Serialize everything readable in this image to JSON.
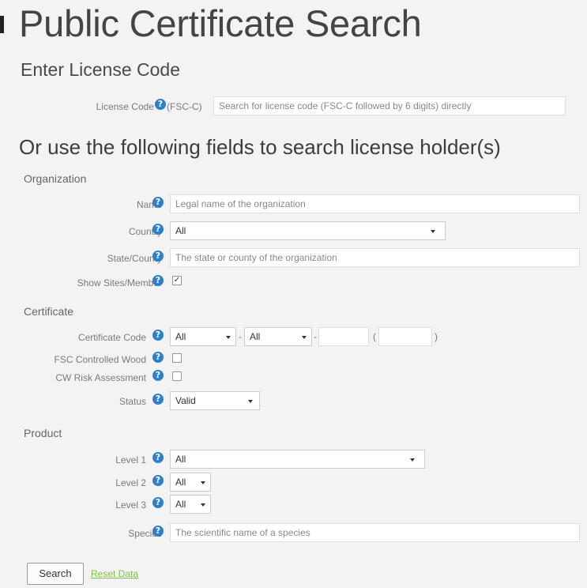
{
  "title": "Public Certificate Search",
  "license_section": {
    "heading": "Enter License Code",
    "label": "License Code",
    "prefix": "(FSC-C)",
    "placeholder": "Search for license code (FSC-C followed by 6 digits) directly"
  },
  "search_heading": "Or use the following fields to search license holder(s)",
  "organization": {
    "heading": "Organization",
    "name_label": "Name",
    "name_placeholder": "Legal name of the organization",
    "country_label": "Country",
    "country_value": "All",
    "state_label": "State/County",
    "state_placeholder": "The state or county of the organization",
    "show_sites_label": "Show Sites/Member",
    "show_sites_checked": true
  },
  "certificate": {
    "heading": "Certificate",
    "code_label": "Certificate Code",
    "code_select1": "All",
    "code_select2": "All",
    "sep1": "-",
    "sep2": "-",
    "paren_open": "(",
    "paren_close": ")",
    "controlled_wood_label": "FSC Controlled Wood",
    "controlled_wood_checked": false,
    "cw_risk_label": "CW Risk Assessment",
    "cw_risk_checked": false,
    "status_label": "Status",
    "status_value": "Valid"
  },
  "product": {
    "heading": "Product",
    "level1_label": "Level 1",
    "level1_value": "All",
    "level2_label": "Level 2",
    "level2_value": "All",
    "level3_label": "Level 3",
    "level3_value": "All",
    "species_label": "Species",
    "species_placeholder": "The scientific name of a species"
  },
  "actions": {
    "search_label": "Search",
    "reset_label": "Reset Data"
  },
  "icons": {
    "help": "help-icon"
  },
  "colors": {
    "help_icon": "#2e7fc9",
    "reset_link": "#7fbf3f",
    "background": "#f3f3f3"
  }
}
